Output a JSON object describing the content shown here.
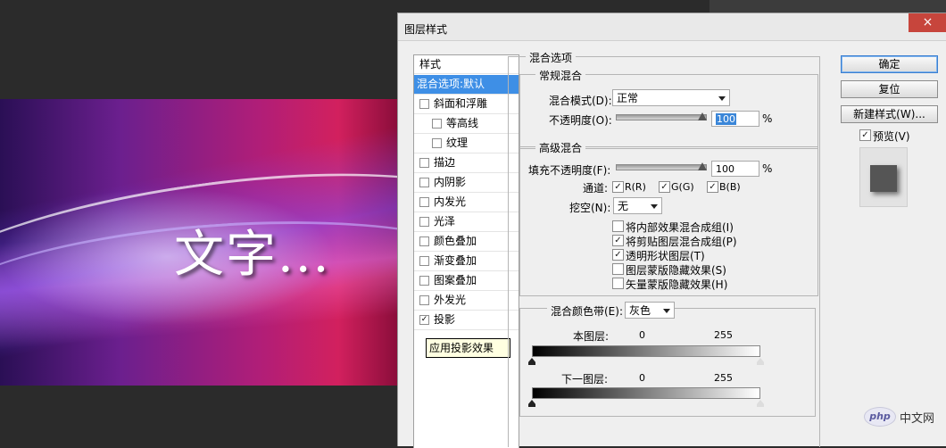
{
  "canvas": {
    "text": "文字..."
  },
  "dialog": {
    "title": "图层样式",
    "close_icon": "×",
    "style_list": {
      "header": "样式",
      "items": [
        {
          "label": "混合选项:默认",
          "checked": null,
          "indent": 0,
          "selected": true
        },
        {
          "label": "斜面和浮雕",
          "checked": false,
          "indent": 0
        },
        {
          "label": "等高线",
          "checked": false,
          "indent": 1
        },
        {
          "label": "纹理",
          "checked": false,
          "indent": 1
        },
        {
          "label": "描边",
          "checked": false,
          "indent": 0
        },
        {
          "label": "内阴影",
          "checked": false,
          "indent": 0
        },
        {
          "label": "内发光",
          "checked": false,
          "indent": 0
        },
        {
          "label": "光泽",
          "checked": false,
          "indent": 0
        },
        {
          "label": "颜色叠加",
          "checked": false,
          "indent": 0
        },
        {
          "label": "渐变叠加",
          "checked": false,
          "indent": 0
        },
        {
          "label": "图案叠加",
          "checked": false,
          "indent": 0
        },
        {
          "label": "外发光",
          "checked": false,
          "indent": 0
        },
        {
          "label": "投影",
          "checked": true,
          "indent": 0
        }
      ],
      "tooltip": "应用投影效果"
    },
    "blend_options": {
      "title": "混合选项",
      "general": {
        "title": "常规混合",
        "mode_label": "混合模式(D):",
        "mode_value": "正常",
        "opacity_label": "不透明度(O):",
        "opacity_value": "100",
        "percent": "%"
      },
      "advanced": {
        "title": "高级混合",
        "fill_label": "填充不透明度(F):",
        "fill_value": "100",
        "percent": "%",
        "channels_label": "通道:",
        "channel_r": "R(R)",
        "channel_g": "G(G)",
        "channel_b": "B(B)",
        "knockout_label": "挖空(N):",
        "knockout_value": "无",
        "options": [
          {
            "label": "将内部效果混合成组(I)",
            "checked": false
          },
          {
            "label": "将剪贴图层混合成组(P)",
            "checked": true
          },
          {
            "label": "透明形状图层(T)",
            "checked": true
          },
          {
            "label": "图层蒙版隐藏效果(S)",
            "checked": false
          },
          {
            "label": "矢量蒙版隐藏效果(H)",
            "checked": false
          }
        ]
      },
      "blend_if": {
        "label": "混合颜色带(E):",
        "value": "灰色",
        "this_layer": "本图层:",
        "this_low": "0",
        "this_high": "255",
        "underlying_layer": "下一图层:",
        "under_low": "0",
        "under_high": "255"
      }
    },
    "buttons": {
      "ok": "确定",
      "reset": "复位",
      "new_style": "新建样式(W)...",
      "preview_label": "预览(V)"
    }
  },
  "watermark": {
    "logo": "php",
    "text": "中文网"
  }
}
